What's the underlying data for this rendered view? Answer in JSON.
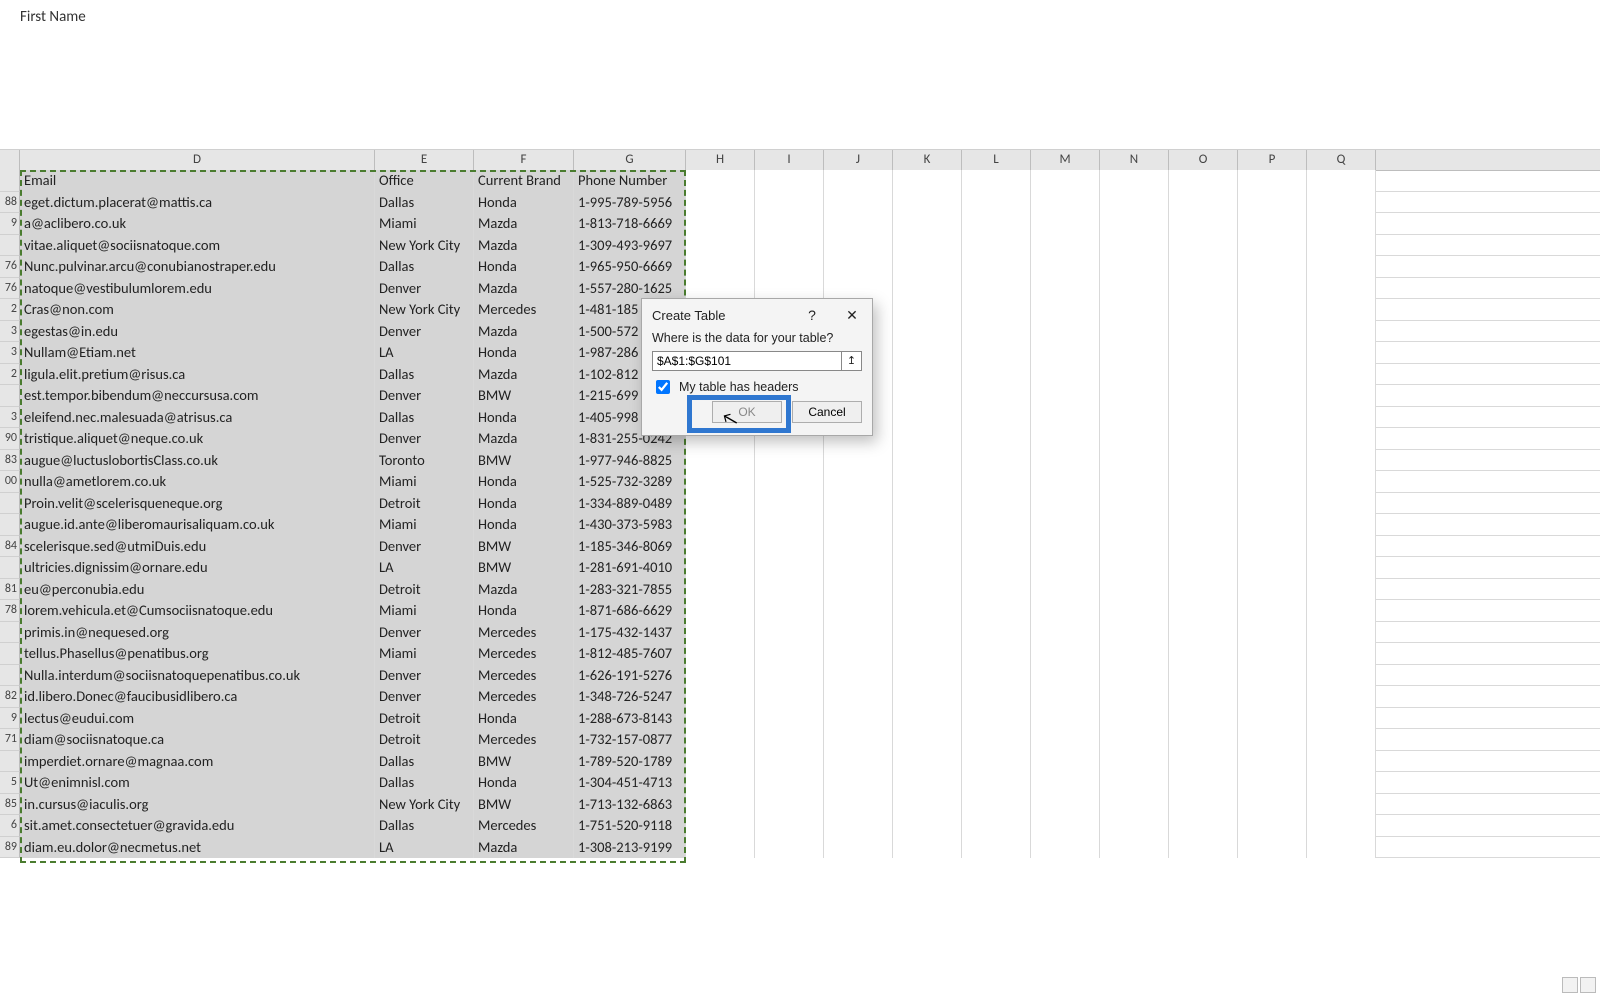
{
  "formula_bar_text": "First Name",
  "columns": [
    "D",
    "E",
    "F",
    "G",
    "H",
    "I",
    "J",
    "K",
    "L",
    "M",
    "N",
    "O",
    "P",
    "Q"
  ],
  "row_numbers": [
    "",
    "88",
    "9",
    "",
    "76",
    "76",
    "2",
    "3",
    "3",
    "2",
    "",
    "3",
    "90",
    "83",
    "00",
    "",
    "",
    "84",
    "",
    "81",
    "78",
    "",
    "",
    "",
    "82",
    "9",
    "71",
    "",
    "5",
    "85",
    "6",
    "89"
  ],
  "headers": {
    "email": "Email",
    "office": "Office",
    "brand": "Current Brand",
    "phone": "Phone Number"
  },
  "rows": [
    {
      "email": "eget.dictum.placerat@mattis.ca",
      "office": "Dallas",
      "brand": "Honda",
      "phone": "1-995-789-5956"
    },
    {
      "email": "a@aclibero.co.uk",
      "office": "Miami",
      "brand": "Mazda",
      "phone": "1-813-718-6669"
    },
    {
      "email": "vitae.aliquet@sociisnatoque.com",
      "office": "New York City",
      "brand": "Mazda",
      "phone": "1-309-493-9697"
    },
    {
      "email": "Nunc.pulvinar.arcu@conubianostraper.edu",
      "office": "Dallas",
      "brand": "Honda",
      "phone": "1-965-950-6669"
    },
    {
      "email": "natoque@vestibulumlorem.edu",
      "office": "Denver",
      "brand": "Mazda",
      "phone": "1-557-280-1625"
    },
    {
      "email": "Cras@non.com",
      "office": "New York City",
      "brand": "Mercedes",
      "phone": "1-481-185"
    },
    {
      "email": "egestas@in.edu",
      "office": "Denver",
      "brand": "Mazda",
      "phone": "1-500-572"
    },
    {
      "email": "Nullam@Etiam.net",
      "office": "LA",
      "brand": "Honda",
      "phone": "1-987-286"
    },
    {
      "email": "ligula.elit.pretium@risus.ca",
      "office": "Dallas",
      "brand": "Mazda",
      "phone": "1-102-812"
    },
    {
      "email": "est.tempor.bibendum@neccursusa.com",
      "office": "Denver",
      "brand": "BMW",
      "phone": "1-215-699"
    },
    {
      "email": "eleifend.nec.malesuada@atrisus.ca",
      "office": "Dallas",
      "brand": "Honda",
      "phone": "1-405-998"
    },
    {
      "email": "tristique.aliquet@neque.co.uk",
      "office": "Denver",
      "brand": "Mazda",
      "phone": "1-831-255-0242"
    },
    {
      "email": "augue@luctuslobortisClass.co.uk",
      "office": "Toronto",
      "brand": "BMW",
      "phone": "1-977-946-8825"
    },
    {
      "email": "nulla@ametlorem.co.uk",
      "office": "Miami",
      "brand": "Honda",
      "phone": "1-525-732-3289"
    },
    {
      "email": "Proin.velit@scelerisqueneque.org",
      "office": "Detroit",
      "brand": "Honda",
      "phone": "1-334-889-0489"
    },
    {
      "email": "augue.id.ante@liberomaurisaliquam.co.uk",
      "office": "Miami",
      "brand": "Honda",
      "phone": "1-430-373-5983"
    },
    {
      "email": "scelerisque.sed@utmiDuis.edu",
      "office": "Denver",
      "brand": "BMW",
      "phone": "1-185-346-8069"
    },
    {
      "email": "ultricies.dignissim@ornare.edu",
      "office": "LA",
      "brand": "BMW",
      "phone": "1-281-691-4010"
    },
    {
      "email": "eu@perconubia.edu",
      "office": "Detroit",
      "brand": "Mazda",
      "phone": "1-283-321-7855"
    },
    {
      "email": "lorem.vehicula.et@Cumsociisnatoque.edu",
      "office": "Miami",
      "brand": "Honda",
      "phone": "1-871-686-6629"
    },
    {
      "email": "primis.in@nequesed.org",
      "office": "Denver",
      "brand": "Mercedes",
      "phone": "1-175-432-1437"
    },
    {
      "email": "tellus.Phasellus@penatibus.org",
      "office": "Miami",
      "brand": "Mercedes",
      "phone": "1-812-485-7607"
    },
    {
      "email": "Nulla.interdum@sociisnatoquepenatibus.co.uk",
      "office": "Denver",
      "brand": "Mercedes",
      "phone": "1-626-191-5276"
    },
    {
      "email": "id.libero.Donec@faucibusidlibero.ca",
      "office": "Denver",
      "brand": "Mercedes",
      "phone": "1-348-726-5247"
    },
    {
      "email": "lectus@eudui.com",
      "office": "Detroit",
      "brand": "Honda",
      "phone": "1-288-673-8143"
    },
    {
      "email": "diam@sociisnatoque.ca",
      "office": "Detroit",
      "brand": "Mercedes",
      "phone": "1-732-157-0877"
    },
    {
      "email": "imperdiet.ornare@magnaa.com",
      "office": "Dallas",
      "brand": "BMW",
      "phone": "1-789-520-1789"
    },
    {
      "email": "Ut@enimnisl.com",
      "office": "Dallas",
      "brand": "Honda",
      "phone": "1-304-451-4713"
    },
    {
      "email": "in.cursus@iaculis.org",
      "office": "New York City",
      "brand": "BMW",
      "phone": "1-713-132-6863"
    },
    {
      "email": "sit.amet.consectetuer@gravida.edu",
      "office": "Dallas",
      "brand": "Mercedes",
      "phone": "1-751-520-9118"
    },
    {
      "email": "diam.eu.dolor@necmetus.net",
      "office": "LA",
      "brand": "Mazda",
      "phone": "1-308-213-9199"
    }
  ],
  "dialog": {
    "title": "Create Table",
    "prompt": "Where is the data for your table?",
    "range_value": "$A$1:$G$101",
    "checkbox_label": "My table has headers",
    "checkbox_checked": true,
    "ok_label": "OK",
    "cancel_label": "Cancel",
    "help_glyph": "?",
    "close_glyph": "✕",
    "collapse_glyph": "↥"
  }
}
